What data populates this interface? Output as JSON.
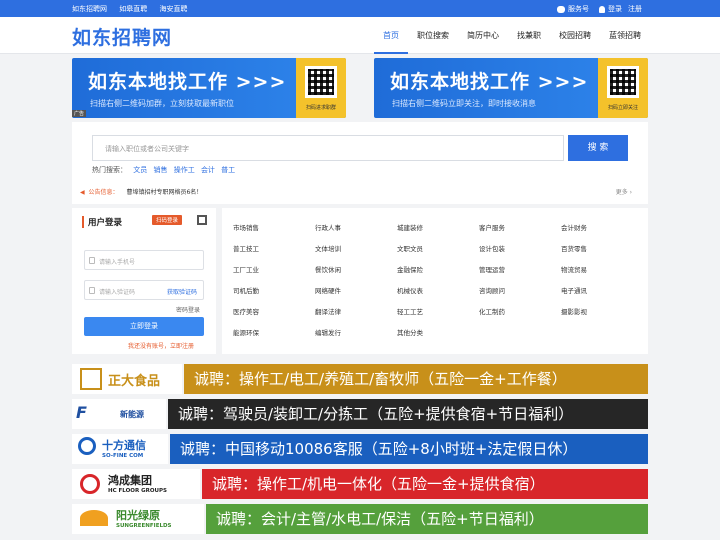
{
  "topbar": {
    "links": [
      "如东招聘网",
      "如皋直聘",
      "海安直聘"
    ],
    "service": "服务号",
    "login": "登录",
    "register": "注册"
  },
  "header": {
    "logo": "如东招聘网",
    "nav": [
      "首页",
      "职位搜索",
      "简历中心",
      "找兼职",
      "校园招聘",
      "蓝领招聘"
    ],
    "active_index": 0
  },
  "banners": [
    {
      "title": "如东本地找工作 >>>",
      "subtitle": "扫描右侧二维码加群，立刻获取最新职位",
      "qr_label": "扫码进求职群"
    },
    {
      "title": "如东本地找工作 >>>",
      "subtitle": "扫描右侧二维码立即关注，即时接收消息",
      "qr_label": "扫码立即关注"
    }
  ],
  "ad_tag": "广告",
  "search": {
    "placeholder": "请输入职位或者公司关键字",
    "button": "搜 索",
    "hot_label": "热门搜索：",
    "hot_keywords": [
      "文员",
      "销售",
      "操作工",
      "会计",
      "普工"
    ]
  },
  "notice": {
    "label": "公告信息：",
    "text": "曹埠镇招村专职网格员6名！",
    "more": "更多 ›"
  },
  "login": {
    "title": "用户登录",
    "scan_label": "扫码登录",
    "phone_placeholder": "请输入手机号",
    "code_placeholder": "请输入验证码",
    "get_code": "获取验证码",
    "password_login": "密码登录",
    "submit": "立即登录",
    "register_link": "我还没有账号，立即注册"
  },
  "categories": [
    "市场销售",
    "行政人事",
    "城建装修",
    "客户服务",
    "会计财务",
    "普工技工",
    "文体培训",
    "文职文员",
    "设计包装",
    "百货零售",
    "工厂工业",
    "餐饮休闲",
    "金融保险",
    "管理运营",
    "物流贸易",
    "司机后勤",
    "网络硬件",
    "机械仪表",
    "咨询顾问",
    "电子通讯",
    "医疗美容",
    "翻译法律",
    "轻工工艺",
    "化工制药",
    "摄影影视",
    "能源环保",
    "编辑发行",
    "其他分类"
  ],
  "job_ads": [
    {
      "brand": "正大食品",
      "text": "诚聘：操作工/电工/养殖工/畜牧师（五险一金+工作餐）",
      "color": "#c8901a"
    },
    {
      "brand": "新能源",
      "text": "诚聘：驾驶员/装卸工/分拣工（五险+提供食宿+节日福利）",
      "color": "#262626"
    },
    {
      "brand": "十方通信",
      "brand_sub": "SO-FINE COM",
      "text": "诚聘：中国移动10086客服（五险+8小时班+法定假日休）",
      "color": "#1a5fbf"
    },
    {
      "brand": "鸿成集团",
      "brand_sub": "HC FLOOR GROUPS",
      "text": "诚聘：操作工/机电一体化（五险一金+提供食宿）",
      "color": "#d8262a"
    },
    {
      "brand": "阳光绿原",
      "brand_sub": "SUNGREENFIELDS",
      "text": "诚聘：会计/主管/水电工/保洁（五险+节日福利）",
      "color": "#55a03c"
    }
  ]
}
